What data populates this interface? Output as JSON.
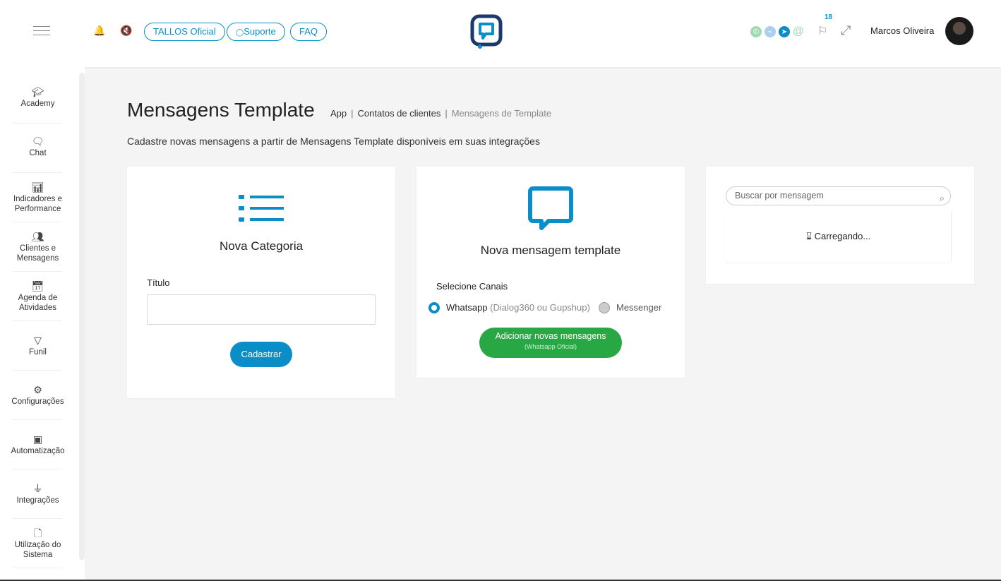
{
  "header": {
    "pills": [
      "TALLOS Oficial",
      "Suporte",
      "FAQ"
    ],
    "notification_count": "18",
    "username": "Marcos Oliveira",
    "channel_icons": [
      "whatsapp-icon",
      "messenger-icon",
      "telegram-icon",
      "email-icon"
    ],
    "accent_color": "#0b8ec7"
  },
  "sidebar": {
    "items": [
      {
        "label": "Academy",
        "icon": "graduation-cap-icon"
      },
      {
        "label": "Chat",
        "icon": "chat-bubbles-icon"
      },
      {
        "label": "Indicadores e Performance",
        "icon": "presentation-chart-icon"
      },
      {
        "label": "Clientes e Mensagens",
        "icon": "users-icon"
      },
      {
        "label": "Agenda de Atividades",
        "icon": "calendar-icon"
      },
      {
        "label": "Funil",
        "icon": "filter-icon"
      },
      {
        "label": "Configurações",
        "icon": "gears-icon"
      },
      {
        "label": "Automatização",
        "icon": "chip-icon"
      },
      {
        "label": "Integrações",
        "icon": "plug-icon"
      },
      {
        "label": "Utilização do Sistema",
        "icon": "document-icon"
      }
    ]
  },
  "page": {
    "title": "Mensagens Template",
    "breadcrumb": [
      "App",
      "Contatos de clientes",
      "Mensagens de Template"
    ],
    "subtitle": "Cadastre novas mensagens a partir de Mensagens Template disponíveis em suas integrações"
  },
  "category_card": {
    "title": "Nova Categoria",
    "field_label": "Título",
    "field_value": "",
    "submit_label": "Cadastrar"
  },
  "template_card": {
    "title": "Nova mensagem template",
    "channels_label": "Selecione Canais",
    "option_whatsapp": "Whatsapp",
    "option_whatsapp_note": "(Dialog360 ou Gupshup)",
    "option_messenger": "Messenger",
    "selected": "Whatsapp",
    "button_label": "Adicionar novas mensagens",
    "button_sublabel": "(Whatsapp Oficial)",
    "button_color": "#28a745"
  },
  "search_card": {
    "placeholder": "Buscar por mensagem",
    "loading_text": "Carregando..."
  }
}
